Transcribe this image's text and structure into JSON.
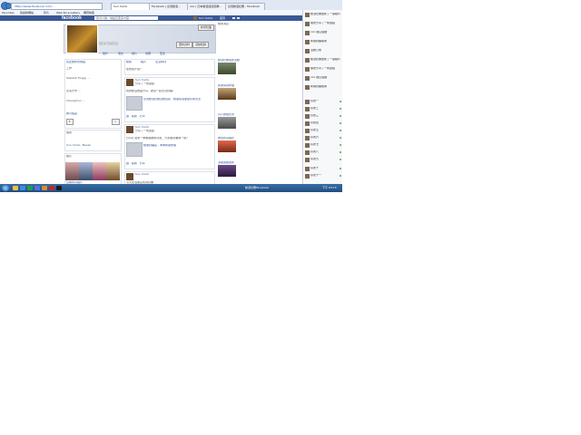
{
  "browser": {
    "url": "https://www.facebook.com/...",
    "search_text": "Sun Yusho",
    "tabs": [
      "Sun Yusho",
      "Facebook | 台灣動漫...",
      "xxx | 日本動漫迷資訊網...",
      "台灣動漫社團 - Facebook"
    ],
    "favorites": [
      "Favorites",
      "建議的網站",
      "影片",
      "Web Slice Gallery",
      "網頁快取"
    ]
  },
  "fb": {
    "logo": "facebook",
    "search_placeholder": "搜尋人物、地點及更多內容",
    "links": [
      "Sun Yusho",
      "首頁"
    ]
  },
  "profile": {
    "name": "Sun Yusho",
    "update_info": "更新資料",
    "activity_log": "活動紀錄",
    "add_cover": "新增封面",
    "tabs": [
      "關於",
      "朋友",
      "相片",
      "地圖",
      "更多"
    ]
  },
  "left": {
    "about_title": "在此處新增地點",
    "work": "工作",
    "edu_title": "教育程度",
    "lines": [
      "Sekolah Tinggi ...",
      "台灣大學 ...",
      "Chengchun ..."
    ],
    "friends_title": "朋友",
    "friends_line": "Sun Yusho, Taiwan",
    "photos_title": "相片",
    "photos_link": "查看所有相片"
  },
  "composer": {
    "status": "動態",
    "photo": "相片",
    "event": "生活時刻",
    "placeholder": "在想些什麼？"
  },
  "posts": [
    {
      "author": "Sun Yusho",
      "meta": "分享了一則連結",
      "text": "我的動漫收藏分享，歡迎一起交流討論！",
      "link_title": "台灣動漫社團活動資訊 - 動畫與漫畫愛好者交流",
      "actions": "讚 · 留言 · 分享"
    },
    {
      "author": "Sun Yusho",
      "meta": "分享了一則連結",
      "text": "[分享] 最新一季動畫推薦清單，大家都在看哪一部？",
      "link_title": "動畫討論區 - 本季新番整理",
      "actions": "讚 · 留言 · 分享"
    },
    {
      "author": "Sun Yusho",
      "meta": "分享了一則連結",
      "text": "今天在漫畫店找到好書",
      "link_title": "",
      "actions": "讚 · 留言 · 分享"
    }
  ],
  "right": {
    "header": "動態消息",
    "items": [
      "動漫社團最新活動",
      "新番情報整理",
      "同人誌販售會",
      "角色扮演攝影",
      "漫畫連載更新"
    ]
  },
  "chat": {
    "ticker": [
      "動漫社團更新了一張相片",
      "朋友分享了一則連結",
      "xxx 說這個讚",
      "新番討論留言",
      "活動公告"
    ],
    "friends": [
      "好友一",
      "好友二",
      "好友三",
      "好友四",
      "好友五",
      "好友六",
      "好友七",
      "好友八",
      "好友九",
      "好友十",
      "好友十一"
    ]
  },
  "taskbar": {
    "items": [
      "動漫社團",
      "Facebook"
    ],
    "clock": "下午 04:15"
  },
  "colors": {
    "fb_blue": "#3b5998",
    "taskbar": "#2a5c8f"
  }
}
